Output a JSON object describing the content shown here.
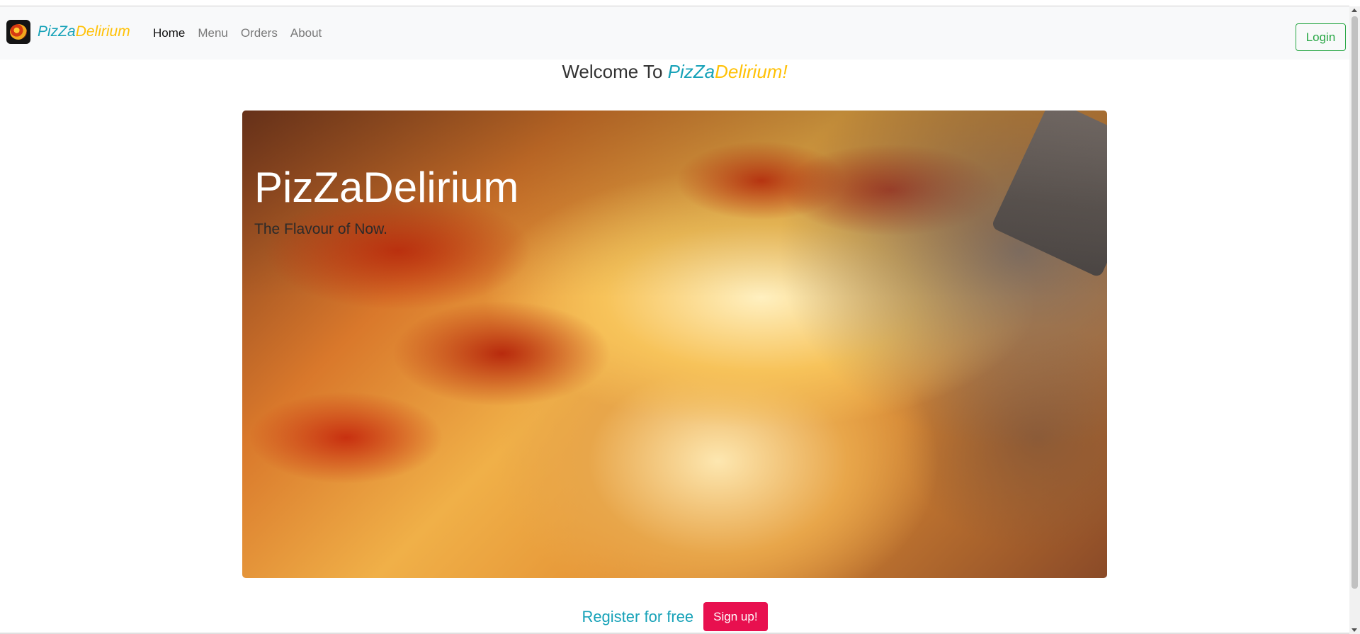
{
  "navbar": {
    "brand": {
      "part1": "PizZa",
      "part2": "Delirium"
    },
    "links": [
      {
        "label": "Home",
        "active": true
      },
      {
        "label": "Menu",
        "active": false
      },
      {
        "label": "Orders",
        "active": false
      },
      {
        "label": "About",
        "active": false
      }
    ],
    "login_label": "Login"
  },
  "welcome": {
    "prefix": "Welcome To ",
    "brand1": "PizZa",
    "brand2": "Delirium!"
  },
  "hero": {
    "title": "PizZaDelirium",
    "subtitle": "The Flavour of Now."
  },
  "cta": {
    "register_text": "Register for free",
    "signup_label": "Sign up!"
  },
  "colors": {
    "brand_teal": "#17a2b8",
    "brand_yellow": "#ffc107",
    "login_green": "#28a745",
    "signup_red": "#e8104f"
  },
  "icons": {
    "logo": "pizza-logo-icon"
  }
}
